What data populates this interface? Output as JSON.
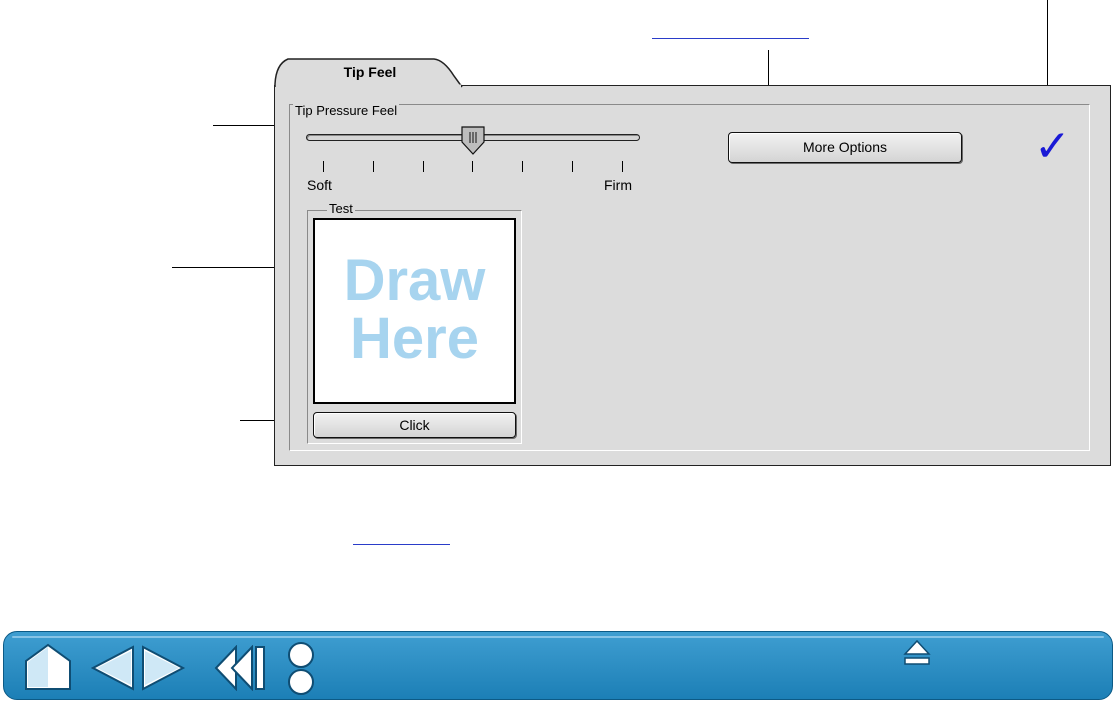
{
  "tab": {
    "label": "Tip Feel"
  },
  "pressure_group": {
    "label": "Tip Pressure Feel",
    "slider": {
      "min_label": "Soft",
      "max_label": "Firm",
      "tick_count": 7,
      "position": 3
    }
  },
  "more_options_button": {
    "label": "More Options"
  },
  "test_group": {
    "label": "Test",
    "draw_area": {
      "line1": "Draw",
      "line2": "Here"
    },
    "click_button": {
      "label": "Click"
    }
  },
  "check_icon": {
    "glyph": "✓",
    "color": "#1a1ad6"
  },
  "navbar": {
    "buttons": [
      "home-icon",
      "previous-page-icon",
      "next-page-icon",
      "back-icon",
      "contents-index-icon",
      "eject-icon"
    ],
    "color": "#2a8cc4"
  },
  "colors": {
    "draw_text": "#a7d4ef",
    "panel": "#dcdcdc",
    "link": "#2a3cc9"
  }
}
